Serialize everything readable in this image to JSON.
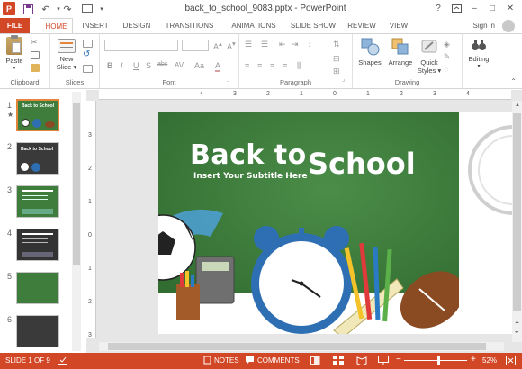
{
  "window": {
    "title": "back_to_school_9083.pptx - PowerPoint",
    "help": "?",
    "minimize": "–",
    "maximize": "□",
    "close": "✕"
  },
  "tabs": [
    "FILE",
    "HOME",
    "INSERT",
    "DESIGN",
    "TRANSITIONS",
    "ANIMATIONS",
    "SLIDE SHOW",
    "REVIEW",
    "VIEW"
  ],
  "active_tab": "HOME",
  "signin": "Sign in",
  "ribbon": {
    "clipboard": {
      "paste": "Paste",
      "label": "Clipboard"
    },
    "slides": {
      "new_slide_1": "New",
      "new_slide_2": "Slide ▾",
      "label": "Slides"
    },
    "font": {
      "label": "Font",
      "bold": "B",
      "italic": "I",
      "underline": "U",
      "strike": "S",
      "shadow": "abc",
      "spacing": "AV",
      "case": "Aa",
      "color": "A"
    },
    "paragraph": {
      "label": "Paragraph"
    },
    "drawing": {
      "shapes": "Shapes",
      "arrange": "Arrange",
      "quick_1": "Quick",
      "quick_2": "Styles ▾",
      "label": "Drawing"
    },
    "editing": {
      "label": "Editing"
    }
  },
  "thumbnails": [
    {
      "num": "1",
      "star": "★",
      "title": "Back to School"
    },
    {
      "num": "2",
      "title": "Back to School"
    },
    {
      "num": "3"
    },
    {
      "num": "4"
    },
    {
      "num": "5"
    },
    {
      "num": "6"
    }
  ],
  "ruler_h": [
    "4",
    "3",
    "2",
    "1",
    "0",
    "1",
    "2",
    "3",
    "4"
  ],
  "ruler_v": [
    "3",
    "2",
    "1",
    "0",
    "1",
    "2",
    "3"
  ],
  "slide": {
    "title_1": "Back to",
    "title_2": "School",
    "subtitle": "Insert Your Subtitle Here"
  },
  "status": {
    "slide_of": "SLIDE 1 OF 9",
    "notes": "NOTES",
    "comments": "COMMENTS",
    "zoom": "52%"
  },
  "colors": {
    "accent": "#d24726",
    "chalkboard": "#3e7d3c"
  }
}
